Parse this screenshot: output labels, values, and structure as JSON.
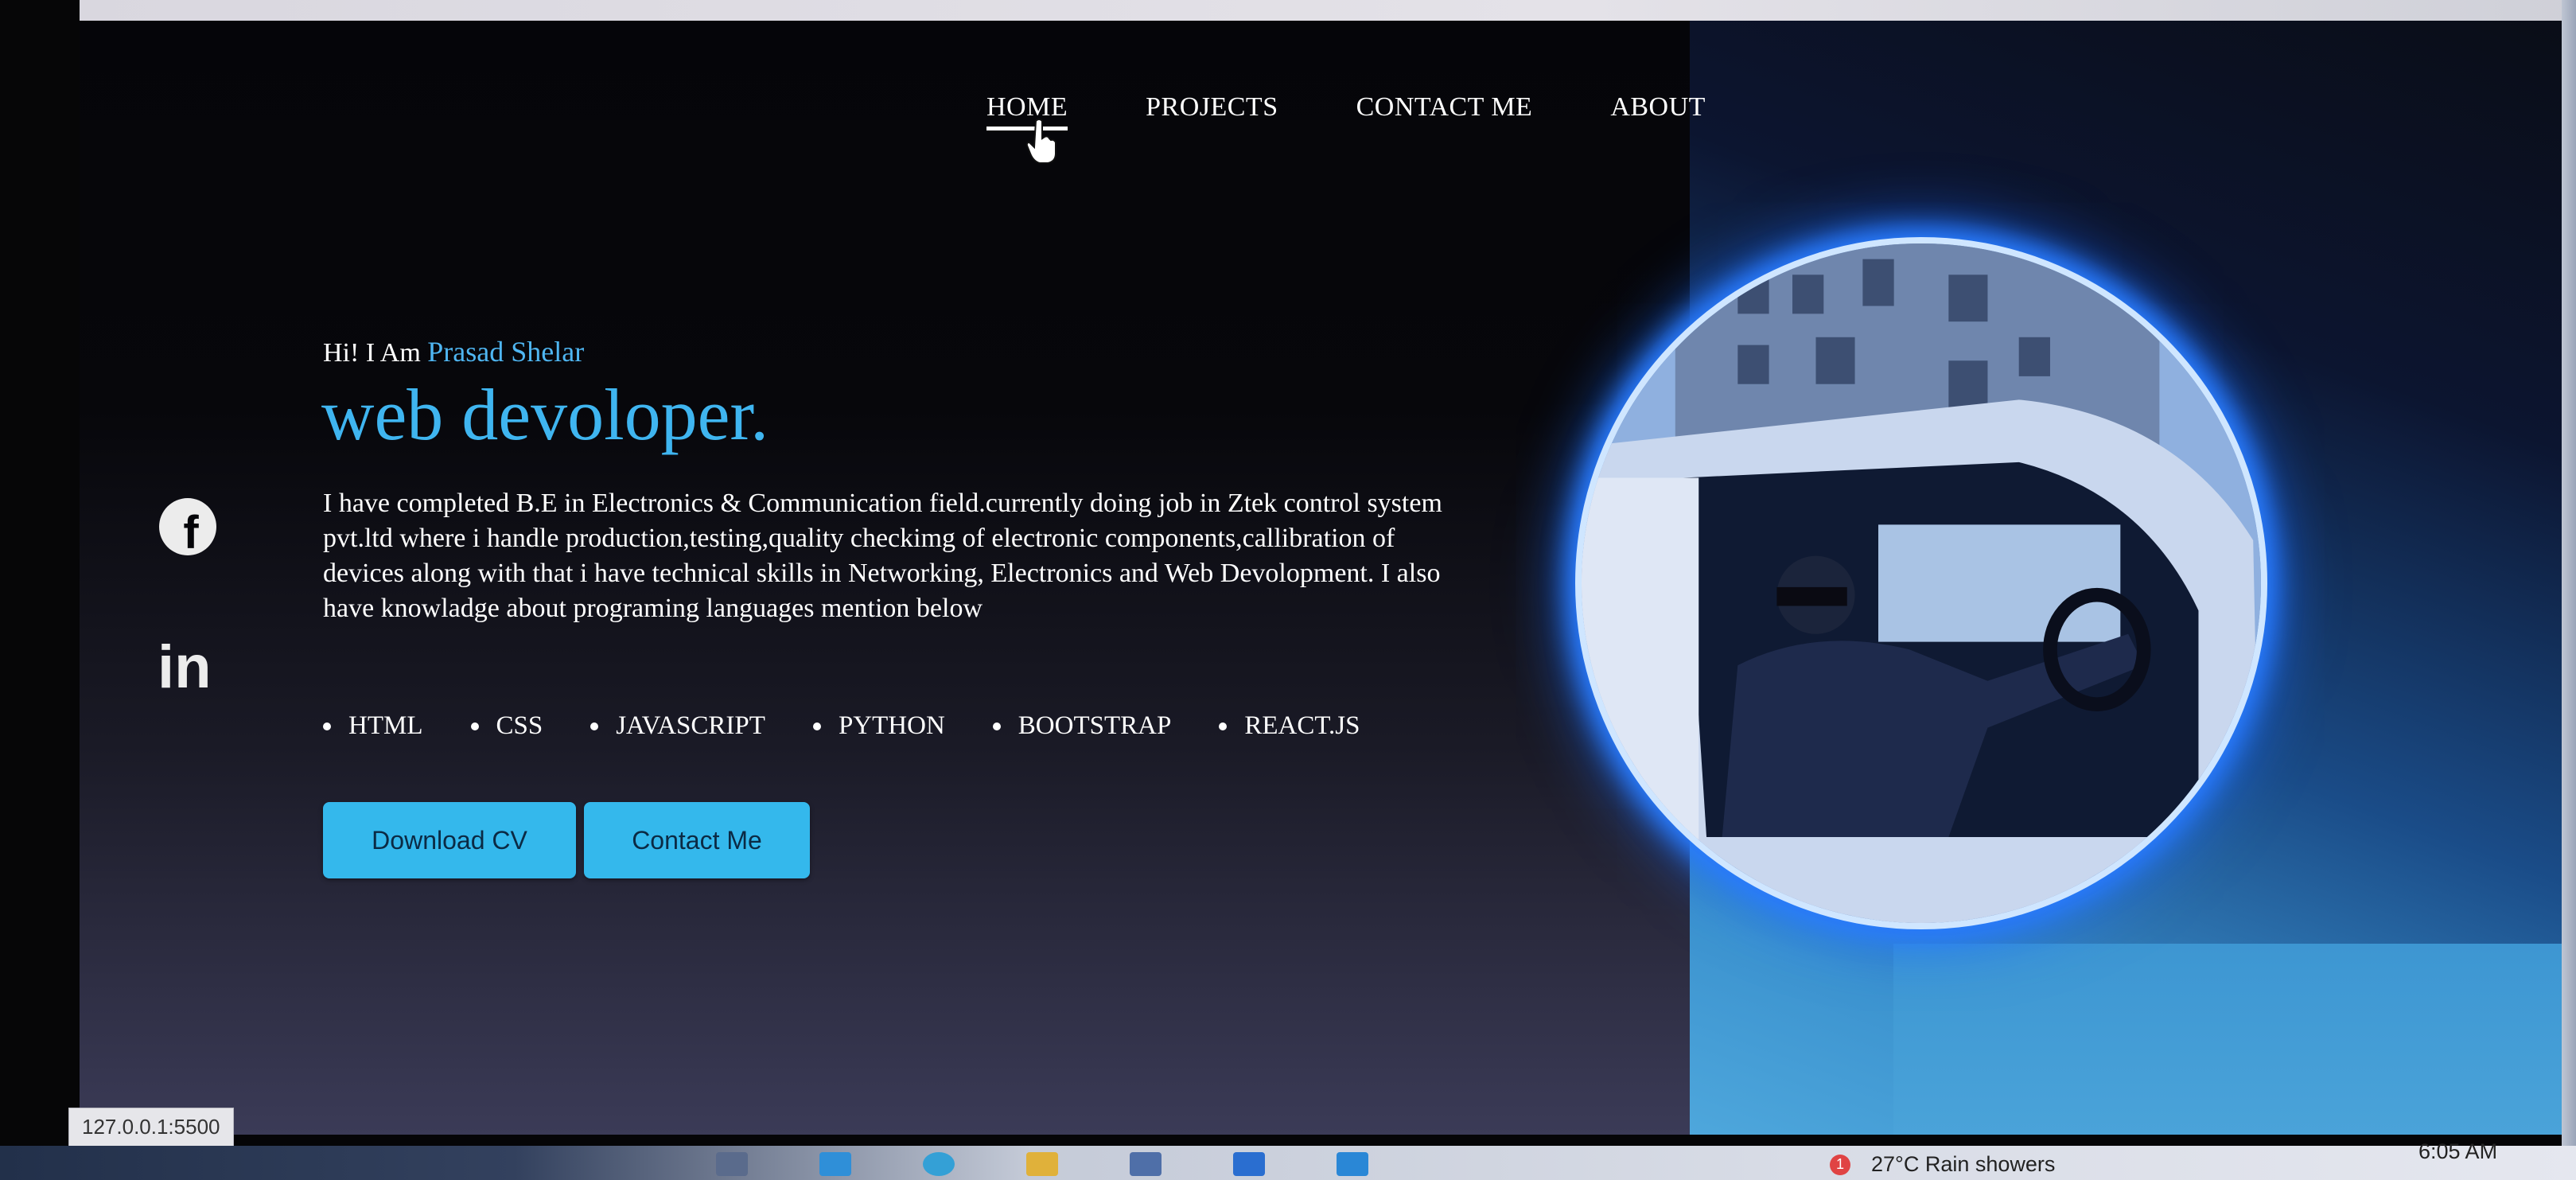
{
  "nav": {
    "items": [
      {
        "label": "HOME",
        "active": true
      },
      {
        "label": "PROJECTS"
      },
      {
        "label": "CONTACT ME"
      },
      {
        "label": "ABOUT"
      }
    ]
  },
  "hero": {
    "greeting_prefix": "Hi! I Am",
    "name": "Prasad Shelar",
    "headline": "web devoloper.",
    "bio": "I have completed B.E in Electronics & Communication field.currently doing job in Ztek control system pvt.ltd where i handle production,testing,quality checkimg of electronic components,callibration of devices along with that i have technical skills in Networking, Electronics and Web Devolopment. I also have knowladge about programing languages mention below",
    "skills": [
      "HTML",
      "CSS",
      "JAVASCRIPT",
      "PYTHON",
      "BOOTSTRAP",
      "REACT.JS"
    ],
    "buttons": {
      "download_cv": "Download CV",
      "contact_me": "Contact Me"
    }
  },
  "social": {
    "icons": [
      "facebook-icon",
      "linkedin-icon"
    ],
    "linkedin_glyph": "in",
    "facebook_glyph": "f"
  },
  "status_bar": {
    "url": "127.0.0.1:5500"
  },
  "taskbar": {
    "weather": "27°C  Rain showers",
    "notification_count": "1",
    "time": "6:05 AM"
  },
  "colors": {
    "accent": "#3fb5f0",
    "button": "#34b8ec",
    "background": "#050509"
  }
}
